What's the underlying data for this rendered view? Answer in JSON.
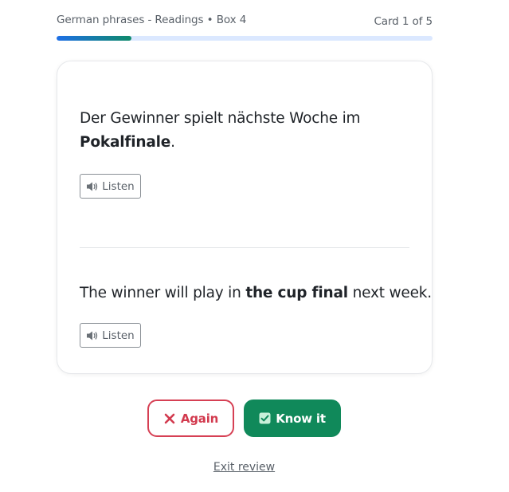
{
  "header": {
    "deck_label": "German phrases - Readings • Box 4",
    "card_counter": "Card 1 of 5"
  },
  "progress": {
    "current": 1,
    "total": 5,
    "fraction": 0.2,
    "colors": {
      "track": "#dbe8ff",
      "fill_start": "#1e6fe6",
      "fill_end": "#0f8a6a"
    }
  },
  "card": {
    "front": {
      "text_before": "Der Gewinner spielt nächste Woche im ",
      "text_bold": "Pokalfinale",
      "text_after": ".",
      "listen_label": "Listen",
      "listen_icon": "speaker-icon"
    },
    "back": {
      "text_before": "The winner will play in ",
      "text_bold": "the cup final",
      "text_after": " next week.",
      "listen_label": "Listen",
      "listen_icon": "speaker-icon"
    }
  },
  "actions": {
    "again_label": "Again",
    "again_icon": "x-icon",
    "again_color": "#d23a4e",
    "know_label": "Know it",
    "know_icon": "check-box-icon",
    "know_color": "#10895a"
  },
  "footer": {
    "exit_label": "Exit review"
  }
}
